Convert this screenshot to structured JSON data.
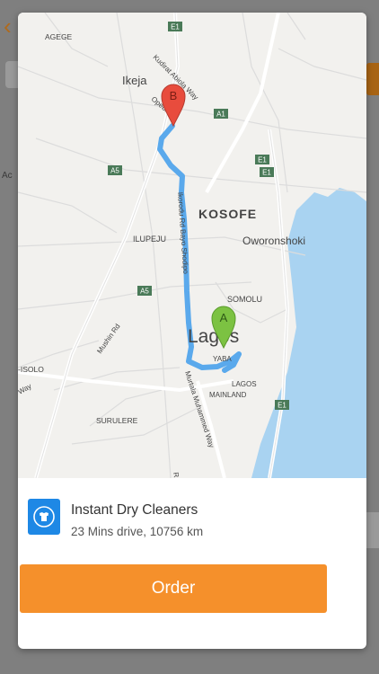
{
  "background": {
    "back_glyph": "‹",
    "left_text": "Ac"
  },
  "map": {
    "labels": {
      "agege": "AGEGE",
      "ikeja": "Ikeja",
      "kudirat": "Kudirat Abiola Way",
      "opebi": "Opebi Rd",
      "a1": "A1",
      "a5_top": "A5",
      "a5_mid": "A5",
      "e1_top": "E1",
      "e1_a": "E1",
      "e1_b": "E1",
      "e1_bottom": "E1",
      "kosofe": "KOSOFE",
      "oworonshoki": "Oworonshoki",
      "ilupeju": "ILUPEJU",
      "ikorodu": "Ikorodu Rd Bayo Shodipo",
      "somolu": "SOMOLU",
      "lagos": "Lagos",
      "yaba": "YABA",
      "lagos_mainland_1": "LAGOS",
      "lagos_mainland_2": "MAINLAND",
      "mushin": "Mushin Rd",
      "isolo": "-ISOLO",
      "way": "Way",
      "murtala": "Murtala Muhammed Way",
      "surulere": "SURULERE",
      "road_r": "R"
    },
    "marker_a": "A",
    "marker_b": "B",
    "colors": {
      "route": "#5aa9ec",
      "water": "#a9d3f1",
      "marker_a": "#7cc242",
      "marker_b": "#e84c3d"
    }
  },
  "shop": {
    "icon": "shirt-hanger-icon",
    "name": "Instant Dry Cleaners",
    "details": "23 Mins drive, 10756 km"
  },
  "order_button": {
    "label": "Order",
    "color": "#f5902b"
  }
}
